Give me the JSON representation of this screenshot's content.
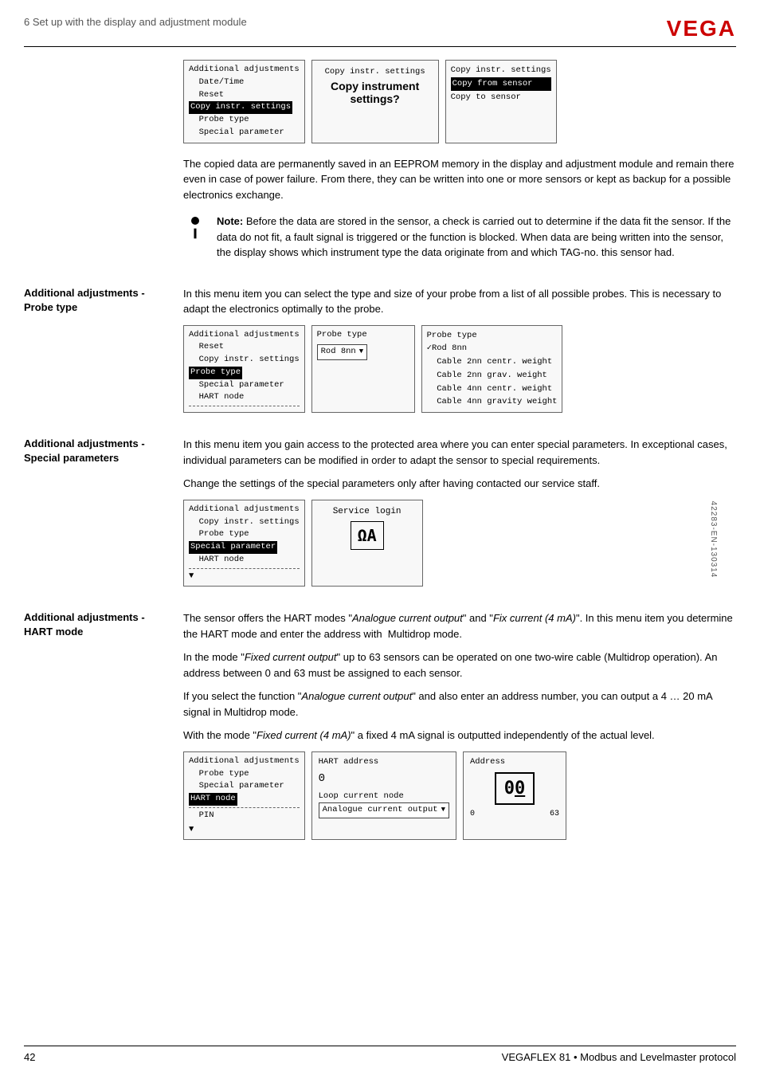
{
  "header": {
    "breadcrumb": "6 Set up with the display and adjustment module",
    "logo": "VEGA",
    "logo_star": "★"
  },
  "footer": {
    "page_number": "42",
    "product_info": "VEGAFLEX 81 • Modbus and Levelmaster protocol"
  },
  "side_text": "42283-EN-130314",
  "section_copy": {
    "label_line1": "Additional adjustments -",
    "description": "The copied data are permanently saved in an EEPROM memory in the display and adjustment module and remain there even in case of power failure. From there, they can be written into one or more sensors or kept as backup for a possible electronics exchange.",
    "menu_screen": {
      "title": "Additional adjustments",
      "items": [
        "Date/Time",
        "Reset",
        "Copy instr. settings",
        "Probe type",
        "Special parameter"
      ],
      "selected": "Copy instr. settings"
    },
    "middle_screen": {
      "top": "Copy instr. settings",
      "main_line1": "Copy instrument",
      "main_line2": "settings?"
    },
    "right_screen": {
      "top": "Copy instr. settings",
      "option1": "Copy from sensor",
      "option2": "Copy to sensor",
      "selected": "Copy from sensor"
    }
  },
  "note": {
    "title": "Note:",
    "text": "Before the data are stored in the sensor, a check is carried out to determine if the data fit the sensor. If the data do not fit, a fault signal is triggered or the function is blocked. When data are being written into the sensor, the display shows which instrument type the data originate from and which TAG-no. this sensor had."
  },
  "section_probe": {
    "label_line1": "Additional adjustments -",
    "label_line2": "Probe type",
    "description": "In this menu item you can select the type and size of your probe from a list of all possible probes. This is necessary to adapt the electronics optimally to the probe.",
    "menu_screen": {
      "title": "Additional adjustments",
      "items": [
        "Reset",
        "Copy instr. settings",
        "Probe type",
        "Special parameter",
        "HART node"
      ],
      "selected": "Probe type",
      "dashed": true
    },
    "middle_screen": {
      "title": "Probe type",
      "value": "Rod 8nn",
      "has_dropdown": true
    },
    "right_screen": {
      "title": "Probe type",
      "options": [
        "Rod 8nn",
        "Cable 2nn centr. weight",
        "Cable 2nn grav. weight",
        "Cable 4nn centr. weight",
        "Cable 4nn gravity weight"
      ],
      "selected": "Rod 8nn"
    }
  },
  "section_special": {
    "label_line1": "Additional adjustments -",
    "label_line2": "Special parameters",
    "description1": "In this menu item you gain access to the protected area where you can enter special parameters. In exceptional cases, individual parameters can be modified in order to adapt the sensor to special requirements.",
    "description2": "Change the settings of the special parameters only after having contacted our service staff.",
    "menu_screen": {
      "title": "Additional adjustments",
      "items": [
        "Copy instr. settings",
        "Probe type",
        "Special parameter",
        "HART node"
      ],
      "selected": "Special parameter",
      "dashed": true
    },
    "middle_screen": {
      "title": "Service login",
      "display": "ΩΑ"
    }
  },
  "section_hart": {
    "label_line1": "Additional adjustments -",
    "label_line2": "HART mode",
    "description1": "The sensor offers the HART modes \"Analogue current output\" and \"Fix current (4 mA)\". In this menu item you determine the HART mode and enter the address with  Multidrop mode.",
    "description2": "In the mode \"Fixed current output\" up to 63 sensors can be operated on one two-wire cable (Multidrop operation). An address between 0 and 63 must be assigned to each sensor.",
    "description3": "If you select the function \"Analogue current output\" and also enter an address number, you can output a 4 … 20 mA signal in Multidrop mode.",
    "description4": "With the mode \"Fixed current (4 mA)\" a fixed 4 mA signal is outputted independently of the actual level.",
    "menu_screen": {
      "title": "Additional adjustments",
      "items": [
        "Probe type",
        "Special parameter",
        "HART node"
      ],
      "selected": "HART node",
      "dashed": true,
      "extra": "PIN"
    },
    "middle_screen": {
      "title": "HART address",
      "value": "0",
      "subtitle": "Loop current node",
      "dropdown_value": "Analogue current output"
    },
    "right_screen": {
      "title": "Address",
      "display": "00",
      "range_min": "0",
      "range_max": "63"
    }
  }
}
